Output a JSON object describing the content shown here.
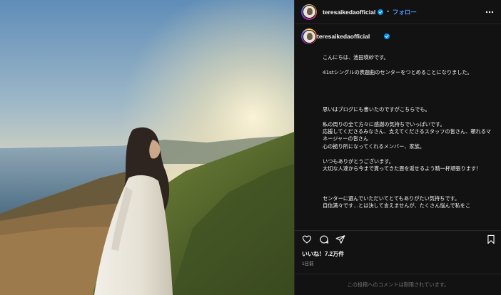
{
  "post": {
    "username": "teresaikedaofficial",
    "verified": true,
    "follow_label": "フォロー",
    "separator": "•"
  },
  "caption": {
    "text": "こんにちは、池田瑛紗です。\n\n41stシングルの表題曲のセンターをつとめることになりました。\n\n\n\n\n思いはブログにも書いたのですがこちらでも。\n\n私の周りの全て方々に感謝の気持ちでいっぱいです。\n応援してくださるみなさん、支えてくださるスタッフの皆さん、頼れるマネージャーの皆さん\n心の拠り所になってくれるメンバー、家族。\n\nいつもありがとうございます。\n大切な人達から今まで貰ってきた恩を返せるよう精一杯頑張ります！\n\n\n\nセンターに選んでいただいてとてもありがたい気持ちです。\n自信満々です...とは決して言えませんが、たくさん悩んで私をこ"
  },
  "stats": {
    "likes_label": "いいね！7.2万件",
    "date_label": "1日前"
  },
  "footer": {
    "comments_disabled": "この投稿へのコメントは制限されています。"
  },
  "icons": {
    "more": "more-horizontal-icon",
    "like": "heart-icon",
    "comment": "comment-icon",
    "share": "share-icon",
    "save": "bookmark-icon",
    "verified": "verified-badge-icon"
  },
  "colors": {
    "panel_bg": "#121212",
    "link_blue": "#4d96ff",
    "verified_blue": "#0095f6",
    "muted_text": "#a8a8a8"
  }
}
